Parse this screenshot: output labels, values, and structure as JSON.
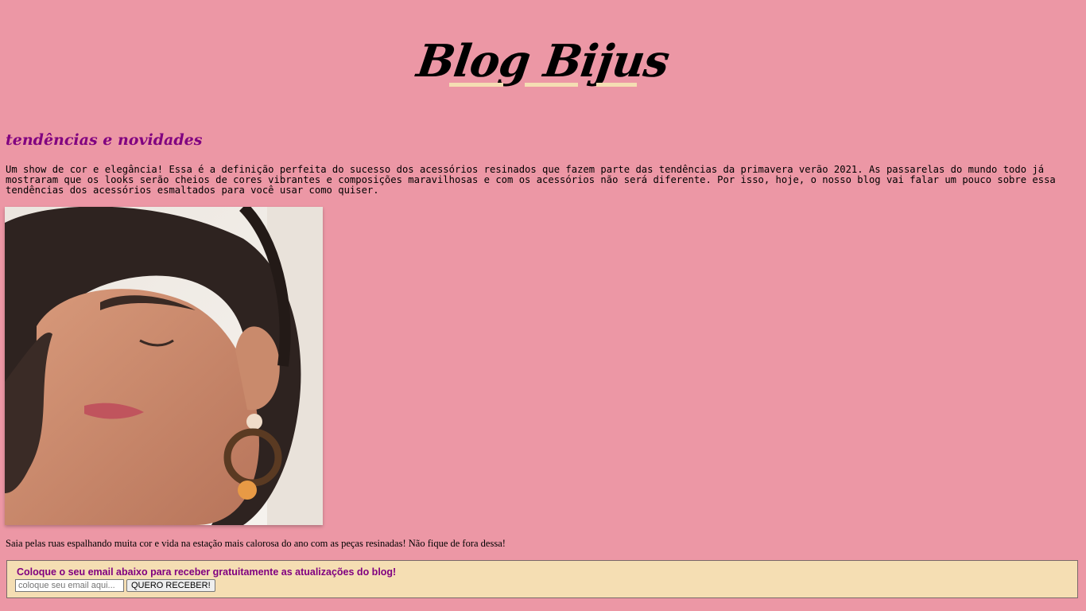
{
  "header": {
    "logo_text": "Blog Bijus"
  },
  "main": {
    "section_title": "tendências e novidades",
    "intro_text": "Um show de cor e elegância! Essa é a definição perfeita do sucesso dos acessórios resinados que fazem parte das tendências da primavera verão 2021. As passarelas do mundo todo já mostraram que os looks serão cheios de cores vibrantes e composições maravilhosas e com os acessórios não será diferente. Por isso, hoje, o nosso blog vai falar um pouco sobre essa tendências dos acessórios esmaltados para você usar como quiser.",
    "caption": "Saia pelas ruas espalhando muita cor e vida na estação mais calorosa do ano com as peças resinadas! Não fique de fora dessa!"
  },
  "newsletter": {
    "title": "Coloque o seu email abaixo para receber gratuitamente as atualizações do blog!",
    "email_placeholder": "coloque seu email aqui...",
    "submit_label": "QUERO RECEBER!"
  },
  "colors": {
    "page_background": "#ec97a5",
    "accent_purple": "#800080",
    "panel_background": "#f5deb3"
  }
}
